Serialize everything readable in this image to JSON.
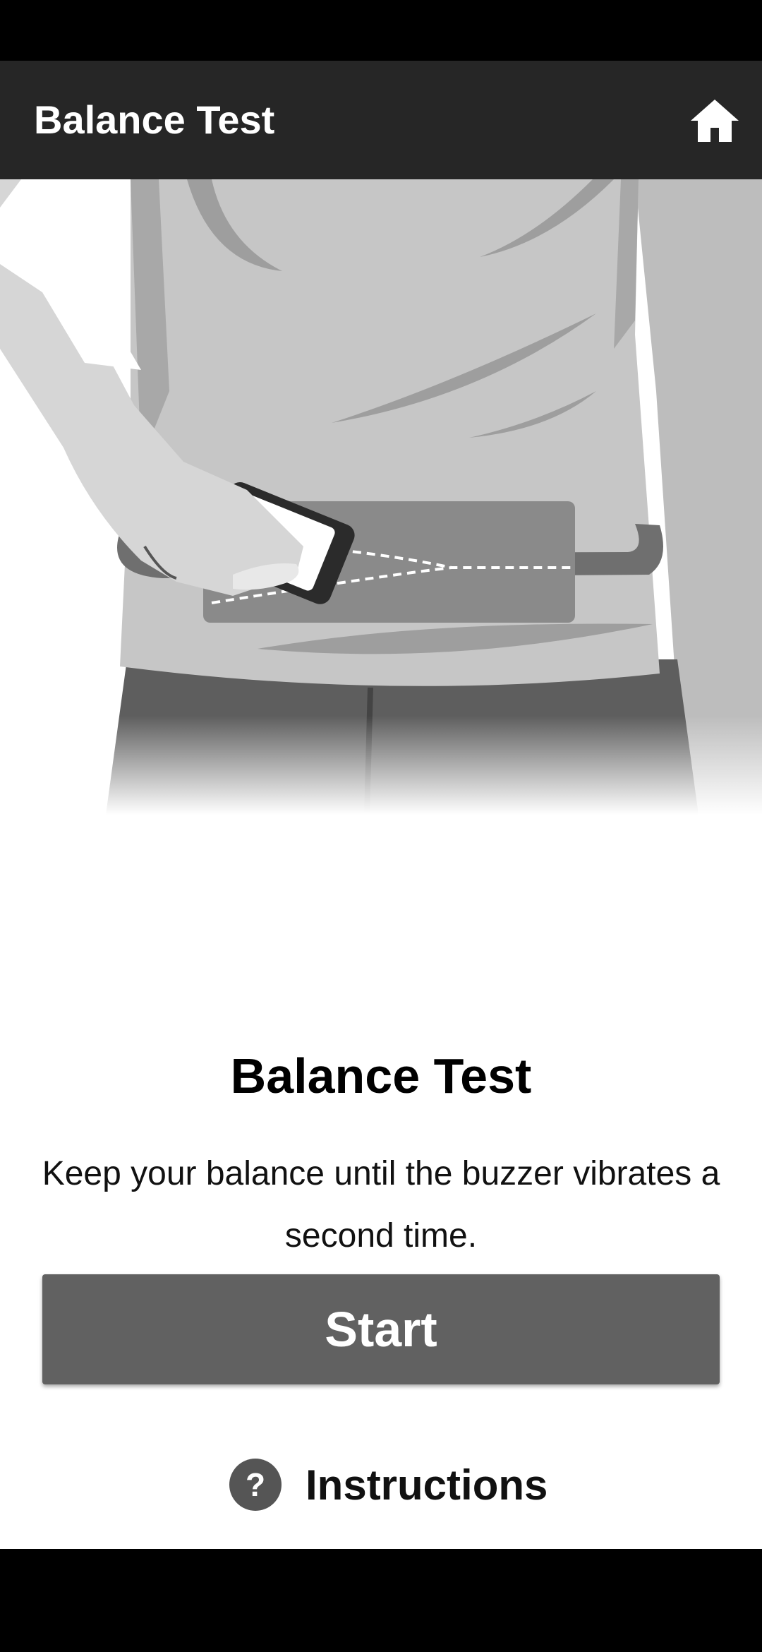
{
  "app_bar": {
    "title": "Balance Test",
    "home_icon": "home-icon"
  },
  "hero": {
    "illustration": "person-placing-phone-in-waist-belt-pouch"
  },
  "main": {
    "title": "Balance Test",
    "description": "Keep your balance until the buzzer vibrates a second time.",
    "start_label": "Start",
    "instructions_label": "Instructions",
    "help_icon_glyph": "?",
    "help_icon": "question-mark-icon"
  },
  "colors": {
    "app_bar_bg": "#262626",
    "button_bg": "#616161",
    "text": "#111111"
  }
}
